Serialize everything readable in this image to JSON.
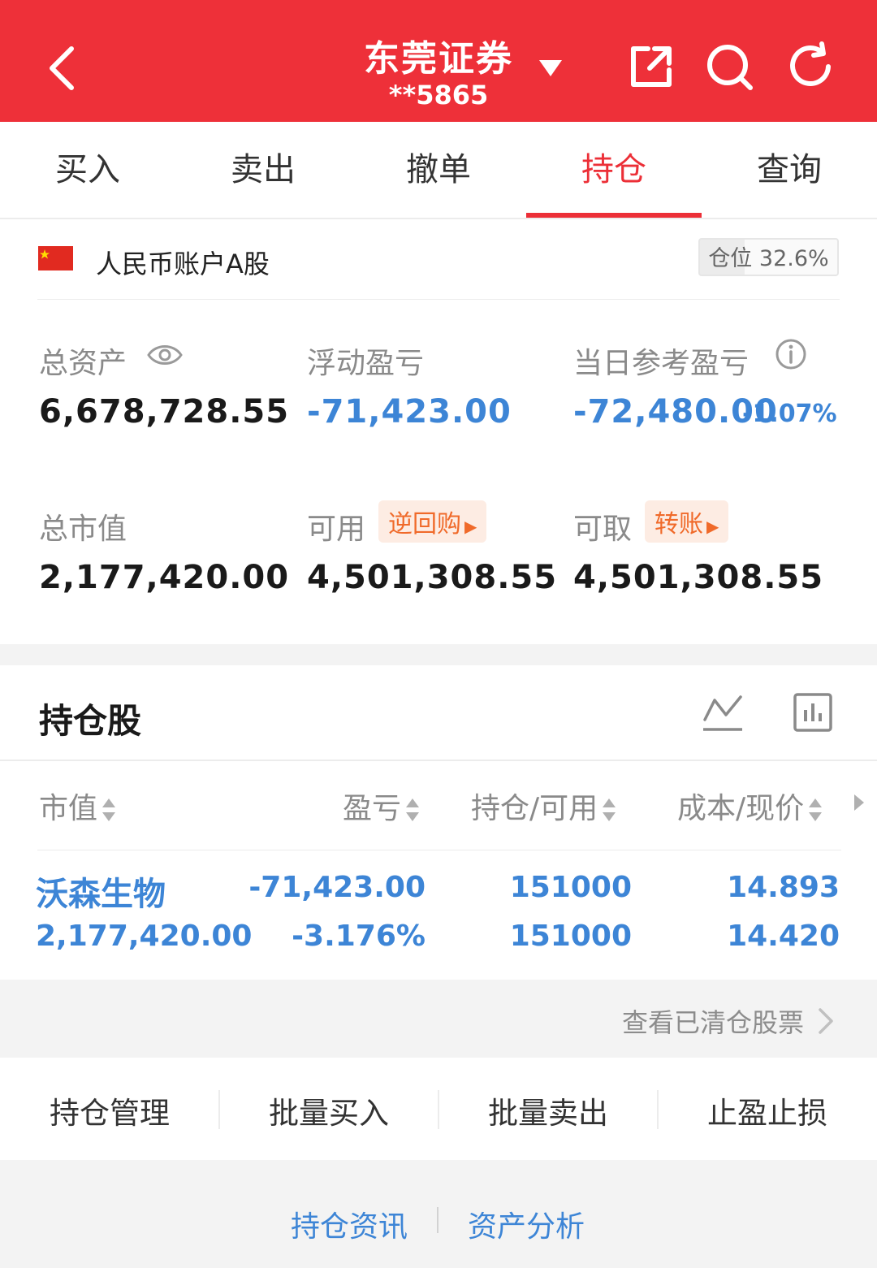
{
  "header": {
    "broker_name": "东莞证券",
    "account_masked": "**5865",
    "colors": {
      "brand_red": "#ee3039",
      "accent_blue": "#3d85d6",
      "tag_orange": "#f06a2a"
    },
    "icons": [
      "back-chevron-icon",
      "dropdown-triangle-icon",
      "share-external-icon",
      "search-icon",
      "refresh-icon"
    ]
  },
  "tabs": [
    {
      "label": "买入",
      "active": false
    },
    {
      "label": "卖出",
      "active": false
    },
    {
      "label": "撤单",
      "active": false
    },
    {
      "label": "持仓",
      "active": true
    },
    {
      "label": "查询",
      "active": false
    }
  ],
  "account": {
    "label": "人民币账户A股",
    "position_ratio_label": "仓位 32.6%",
    "position_ratio_value": 32.6
  },
  "summary": {
    "total_assets_label": "总资产",
    "total_assets": "6,678,728.55",
    "floating_pnl_label": "浮动盈亏",
    "floating_pnl": "-71,423.00",
    "daily_pnl_label": "当日参考盈亏",
    "daily_pnl": "-72,480.00",
    "daily_pnl_pct": "-1.07%",
    "market_value_label": "总市值",
    "market_value": "2,177,420.00",
    "available_label": "可用",
    "available_tag": "逆回购",
    "available": "4,501,308.55",
    "withdrawable_label": "可取",
    "withdrawable_tag": "转账",
    "withdrawable": "4,501,308.55"
  },
  "holdings": {
    "title": "持仓股",
    "columns": [
      "市值",
      "盈亏",
      "持仓/可用",
      "成本/现价"
    ],
    "rows": [
      {
        "name": "沃森生物",
        "market_value": "2,177,420.00",
        "pnl": "-71,423.00",
        "pnl_pct": "-3.176%",
        "position": "151000",
        "available": "151000",
        "cost": "14.893",
        "price": "14.420"
      }
    ],
    "cleared_link": "查看已清仓股票"
  },
  "actions": [
    "持仓管理",
    "批量买入",
    "批量卖出",
    "止盈止损"
  ],
  "footer_links": [
    "持仓资讯",
    "资产分析"
  ]
}
